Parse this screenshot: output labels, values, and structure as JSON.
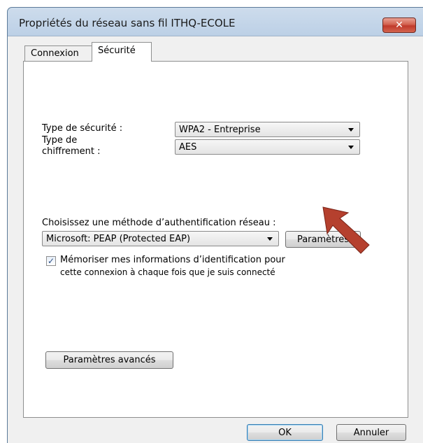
{
  "window": {
    "title": "Propriétés du réseau sans fil ITHQ-ECOLE",
    "close_icon": "x-icon",
    "close_label": "✕"
  },
  "tabs": [
    {
      "label": "Connexion",
      "selected": false
    },
    {
      "label": "Sécurité",
      "selected": true
    }
  ],
  "security": {
    "type_label": "Type de sécurité :",
    "type_value": "WPA2 - Entreprise",
    "encryption_label_line1": "Type de",
    "encryption_label_line2": "chiffrement :",
    "encryption_value": "AES"
  },
  "auth": {
    "method_label": "Choisissez une méthode d’authentification réseau :",
    "method_value": "Microsoft: PEAP (Protected EAP)",
    "settings_button": "Paramètres",
    "remember_checked": true,
    "remember_line1": "Mémoriser mes informations d’identification pour",
    "remember_line2": "cette connexion à chaque fois que je suis connecté"
  },
  "advanced_button": "Paramètres avancés",
  "footer": {
    "ok": "OK",
    "cancel": "Annuler"
  },
  "colors": {
    "annotation_arrow": "#b5402e",
    "close_button": "#c0392b"
  }
}
